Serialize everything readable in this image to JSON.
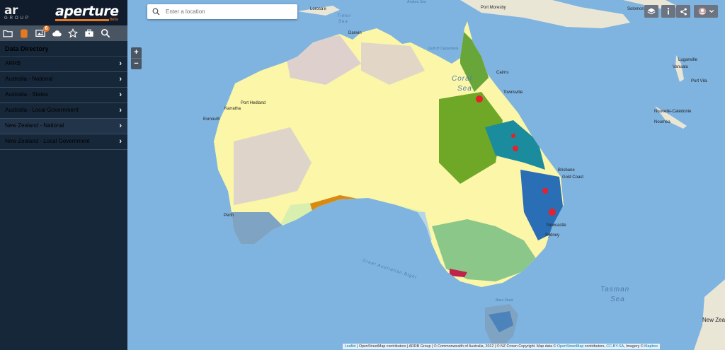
{
  "brand": {
    "arrb": "ar",
    "arrb_sub": "GROUP",
    "aperture": "aperture",
    "aperture_sub": "beta"
  },
  "toolbar": {
    "badge": "6"
  },
  "sidebar": {
    "title": "Data Directory",
    "items": [
      {
        "label": "ARRB"
      },
      {
        "label": "Australia - National"
      },
      {
        "label": "Australia - States"
      },
      {
        "label": "Australia - Local Government"
      },
      {
        "label": "New Zealand - National"
      },
      {
        "label": "New Zealand - Local Government"
      }
    ]
  },
  "search": {
    "placeholder": "Enter a location"
  },
  "zoom": {
    "in": "+",
    "out": "−"
  },
  "map": {
    "seas": [
      "Coral",
      "Sea",
      "Tasman",
      "Sea",
      "Timor",
      "Sea",
      "Gulf of Carpentaria",
      "Great Australian Bight",
      "Arafura Sea",
      "Bass Strait"
    ],
    "places": [
      "Darwin",
      "Cairns",
      "Townsville",
      "Port Moresby",
      "Port Hedland",
      "Karratha",
      "Exmouth",
      "Brisbane",
      "Gold Coast",
      "Newcastle",
      "Sydney",
      "Perth",
      "Luganville",
      "Vanuatu",
      "Port Vila",
      "Nouvelle-Calédonie",
      "Nouméa",
      "Solomon Islands",
      "Lorosa'e",
      "New Zealand"
    ]
  },
  "attribution": {
    "leaflet": "Leaflet",
    "text1": " | OpenStreetMap contributors | ARRB Group | © Commonwealth of Australia, 2012 | © NZ Crown Copyright. Map data © ",
    "osm": "OpenStreetMap",
    "text2": " contributors, ",
    "license": "CC-BY-SA",
    "text3": ", Imagery © ",
    "mapbox": "Mapbox"
  }
}
